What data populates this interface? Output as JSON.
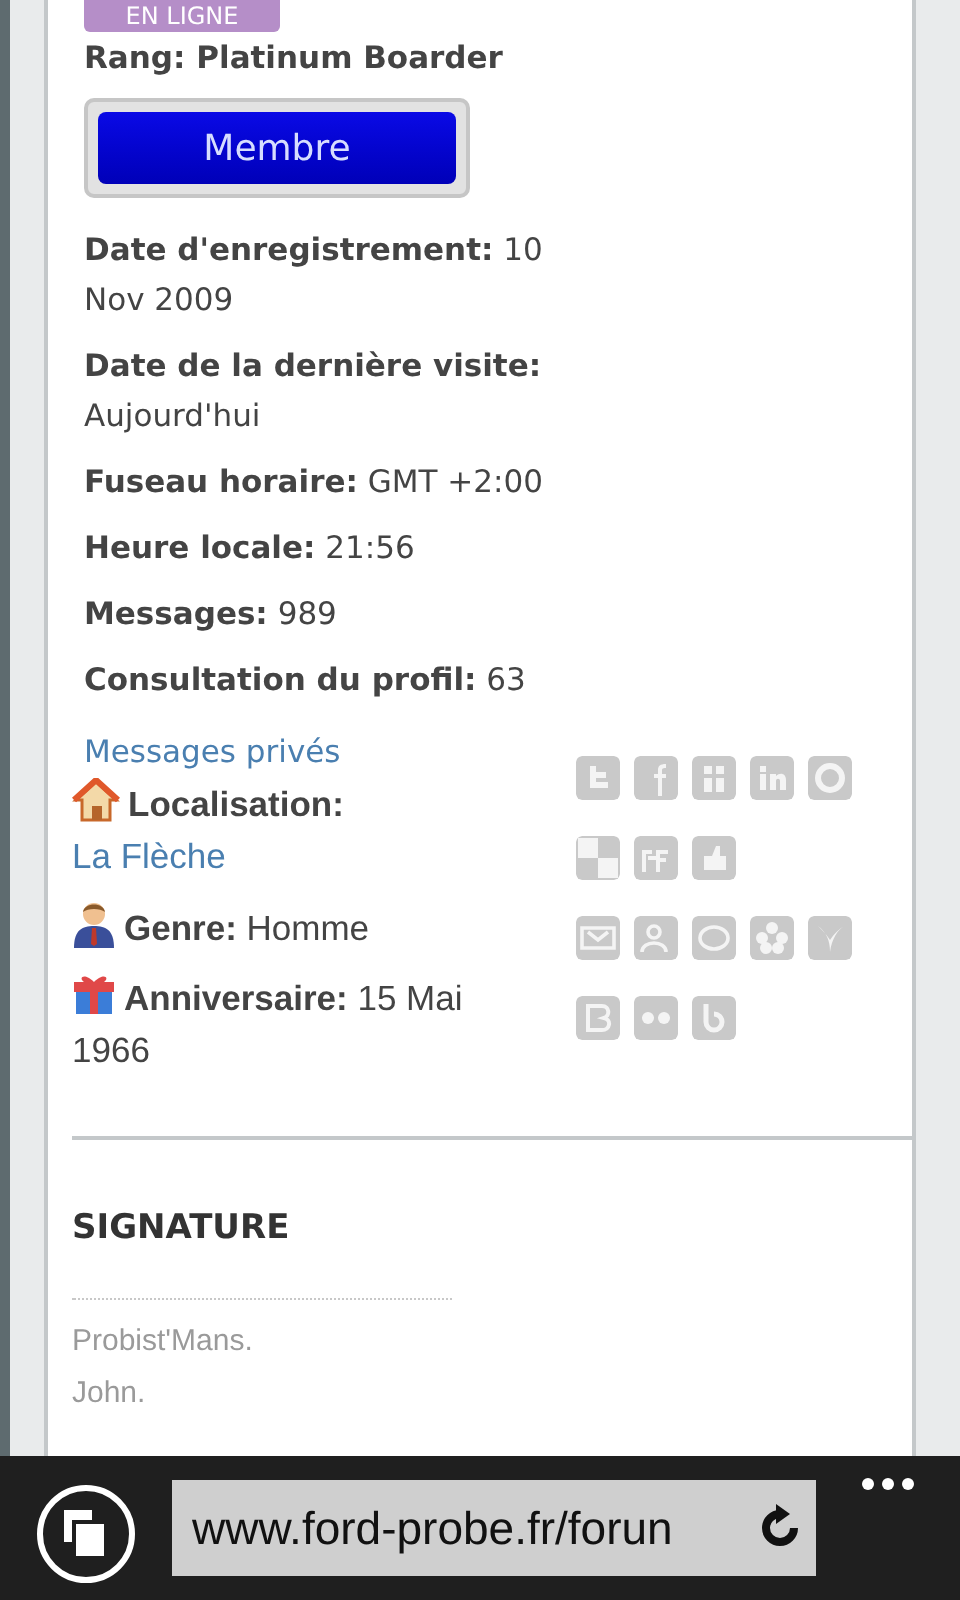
{
  "status_badge": "EN LIGNE",
  "rank": {
    "label": "Rang:",
    "value": "Platinum Boarder"
  },
  "member_button": "Membre",
  "fields": [
    {
      "label": "Date d'enregistrement:",
      "value": "10 Nov 2009"
    },
    {
      "label": "Date de la dernière visite:",
      "value": "Aujourd'hui"
    },
    {
      "label": "Fuseau horaire:",
      "value": "GMT +2:00"
    },
    {
      "label": "Heure locale:",
      "value": "21:56"
    },
    {
      "label": "Messages:",
      "value": "989"
    },
    {
      "label": "Consultation du profil:",
      "value": "63"
    }
  ],
  "private_messages_link": "Messages privés",
  "profile_fields": [
    {
      "kind": "home",
      "label": "Localisation:",
      "value": "La Flèche",
      "link": true
    },
    {
      "kind": "person",
      "label": "Genre:",
      "value": "Homme",
      "link": false
    },
    {
      "kind": "gift",
      "label": "Anniversaire:",
      "value": "15 Mai 1966",
      "link": false
    }
  ],
  "signature": {
    "title": "SIGNATURE",
    "lines": [
      "Probist'Mans.",
      "John."
    ]
  },
  "browser": {
    "url": "www.ford-probe.fr/forun"
  }
}
